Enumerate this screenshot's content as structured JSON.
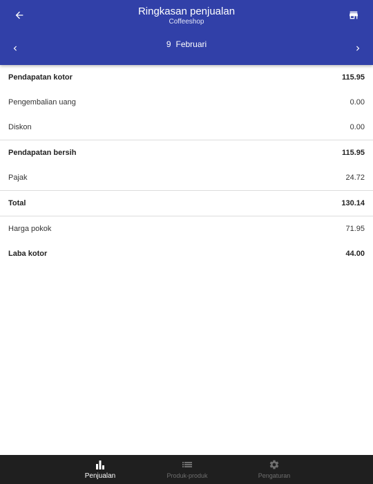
{
  "header": {
    "title": "Ringkasan penjualan",
    "subtitle": "Coffeeshop",
    "date_day": "9",
    "date_month": "Februari",
    "back_icon": "arrow-left-icon",
    "store_icon": "store-icon",
    "prev_icon": "chevron-left-icon",
    "next_icon": "chevron-right-icon"
  },
  "summary": {
    "rows": [
      {
        "label": "Pendapatan kotor",
        "value": "115.95"
      },
      {
        "label": "Pengembalian uang",
        "value": "0.00"
      },
      {
        "label": "Diskon",
        "value": "0.00"
      },
      {
        "label": "Pendapatan bersih",
        "value": "115.95"
      },
      {
        "label": "Pajak",
        "value": "24.72"
      },
      {
        "label": "Total",
        "value": "130.14"
      },
      {
        "label": "Harga pokok",
        "value": "71.95"
      },
      {
        "label": "Laba kotor",
        "value": "44.00"
      }
    ]
  },
  "bottom_nav": {
    "items": [
      {
        "label": "Penjualan",
        "icon": "bar-chart-icon",
        "active": true
      },
      {
        "label": "Produk-produk",
        "icon": "list-icon",
        "active": false
      },
      {
        "label": "Pengaturan",
        "icon": "gear-icon",
        "active": false
      }
    ]
  },
  "colors": {
    "primary": "#3140a8",
    "nav_background": "#1f1f1f",
    "nav_inactive": "#6f6f6f",
    "divider": "#dcdcdc"
  }
}
